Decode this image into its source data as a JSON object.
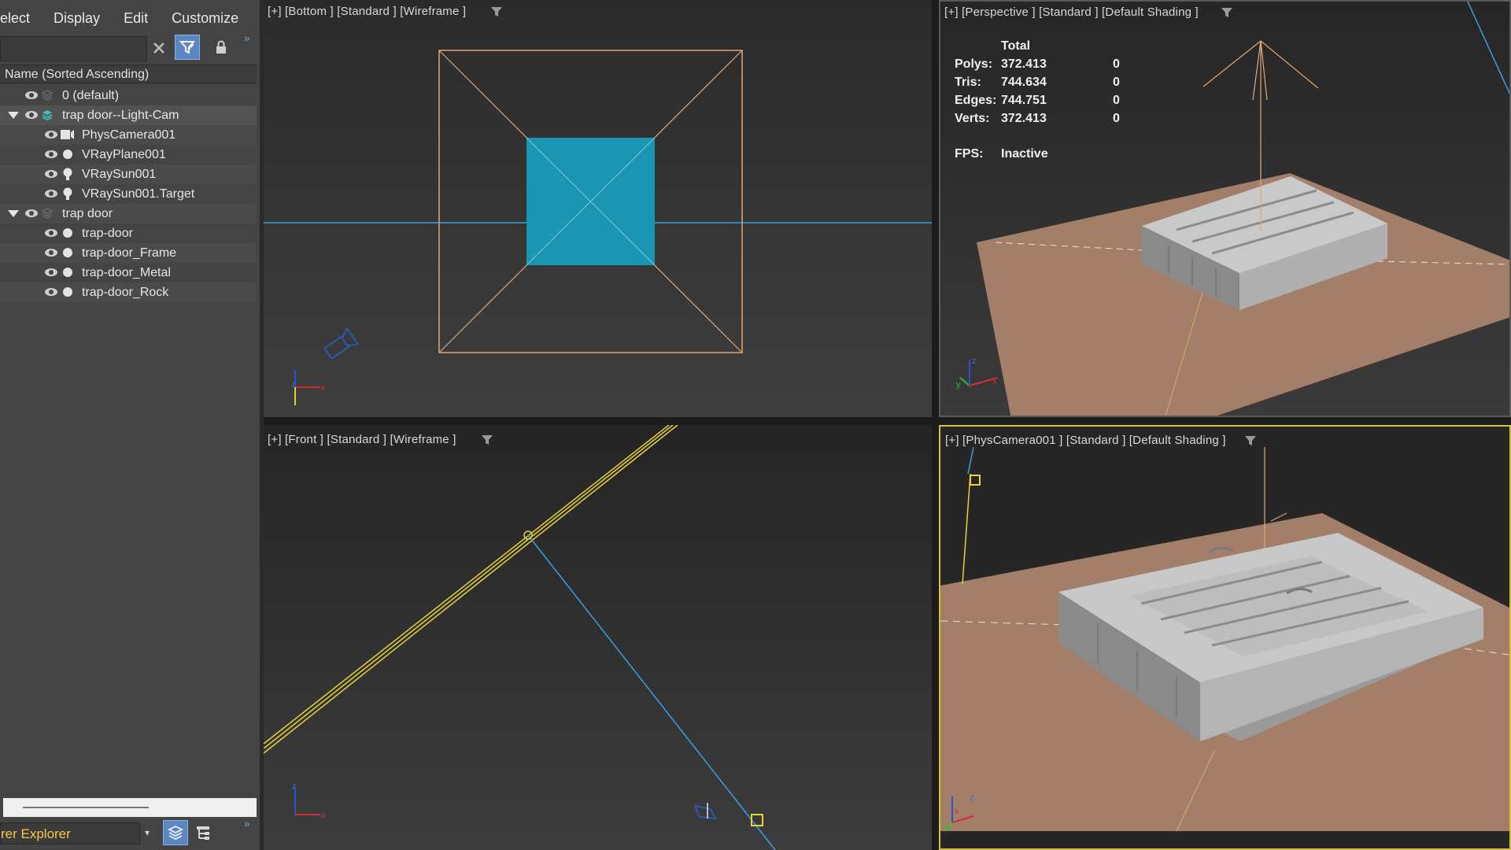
{
  "menu": {
    "items": [
      "elect",
      "Display",
      "Edit",
      "Customize"
    ]
  },
  "scene_explorer": {
    "column_header": "Name (Sorted Ascending)",
    "rows": [
      {
        "label": "0 (default)"
      },
      {
        "label": "trap door--Light-Cam"
      },
      {
        "label": "PhysCamera001"
      },
      {
        "label": "VRayPlane001"
      },
      {
        "label": "VRaySun001"
      },
      {
        "label": "VRaySun001.Target"
      },
      {
        "label": "trap door"
      },
      {
        "label": "trap-door"
      },
      {
        "label": "trap-door_Frame"
      },
      {
        "label": "trap-door_Metal"
      },
      {
        "label": "trap-door_Rock"
      }
    ],
    "explorer_name": "rer Explorer"
  },
  "viewports": {
    "top_left": {
      "label": "[+] [Bottom ] [Standard ] [Wireframe ]"
    },
    "top_right": {
      "label": "[+] [Perspective ] [Standard ] [Default Shading ]"
    },
    "bottom_left": {
      "label": "[+] [Front ] [Standard ] [Wireframe ]"
    },
    "bottom_right": {
      "label": "[+] [PhysCamera001 ] [Standard ] [Default Shading ]"
    }
  },
  "stats": {
    "header": "Total",
    "rows": [
      {
        "label": "Polys:",
        "total": "372.413",
        "sel": "0"
      },
      {
        "label": "Tris:",
        "total": "744.634",
        "sel": "0"
      },
      {
        "label": "Edges:",
        "total": "744.751",
        "sel": "0"
      },
      {
        "label": "Verts:",
        "total": "372.413",
        "sel": "0"
      }
    ],
    "fps_label": "FPS:",
    "fps_value": "Inactive"
  },
  "axis_labels": {
    "x": "x",
    "y": "y",
    "z": "z"
  },
  "colors": {
    "panel": "#444444",
    "ground": "#a37f69",
    "wire_orange": "#e0a878",
    "blue_line": "#3aa0e0",
    "yellow_line": "#e6d23a",
    "teal_plane": "#1b96b2",
    "active_border": "#d6c23a"
  },
  "icons": [
    "close-icon",
    "filter-icon",
    "lock-icon",
    "expand-icon",
    "layers-icon",
    "hierarchy-icon",
    "eye-icon",
    "filter-funnel-icon"
  ]
}
